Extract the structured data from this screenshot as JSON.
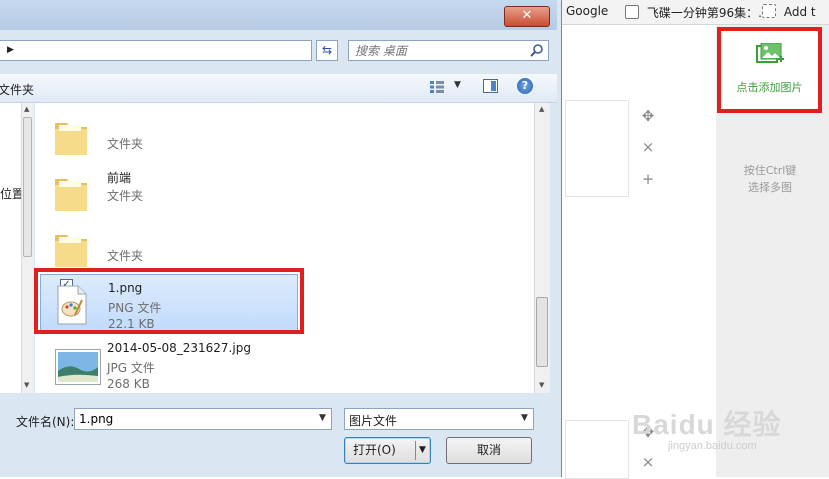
{
  "bookmarks": {
    "items": [
      {
        "label": "Google"
      },
      {
        "label": "飞碟一分钟第96集：..."
      },
      {
        "label": "Add t"
      }
    ]
  },
  "uploader": {
    "add_image_label": "点击添加图片",
    "ctrl_hint_line1": "按住Ctrl键",
    "ctrl_hint_line2": "选择多图",
    "tools": {
      "move": "✥",
      "close": "×",
      "add": "+"
    }
  },
  "watermark": {
    "text": "Baidu 经验",
    "sub": "jingyan.baidu.com"
  },
  "dialog": {
    "close_label": "✕",
    "address_arrow": "▶",
    "search_placeholder": "搜索 桌面",
    "toolbar_label": "文件夹",
    "nav_label": "位置",
    "files": [
      {
        "name": "",
        "type": "文件夹",
        "size": "",
        "kind": "folder"
      },
      {
        "name": "前端",
        "type": "文件夹",
        "size": "",
        "kind": "folder"
      },
      {
        "name": "",
        "type": "文件夹",
        "size": "",
        "kind": "folder"
      },
      {
        "name": "1.png",
        "type": "PNG 文件",
        "size": "22.1 KB",
        "kind": "png",
        "selected": true
      },
      {
        "name": "2014-05-08_231627.jpg",
        "type": "JPG 文件",
        "size": "268 KB",
        "kind": "jpg"
      }
    ],
    "filename_label": "文件名(N):",
    "filename_value": "1.png",
    "filter_value": "图片文件",
    "open_button": "打开(O)",
    "cancel_button": "取消"
  }
}
